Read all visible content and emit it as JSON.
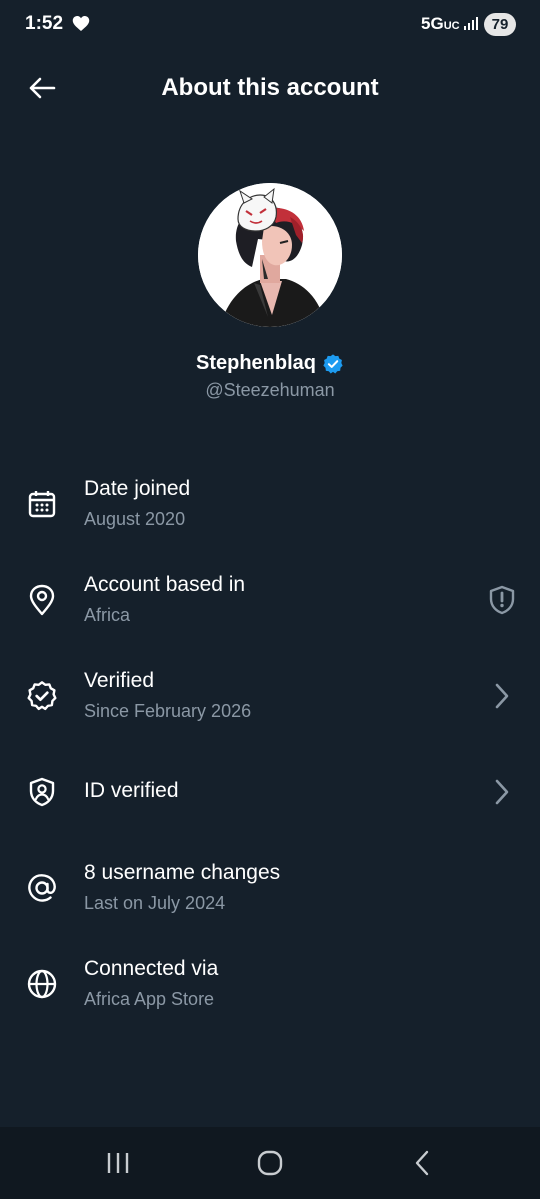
{
  "status_bar": {
    "time": "1:52",
    "network": "5G",
    "network_suffix": "UC",
    "battery": "79"
  },
  "header": {
    "title": "About this account",
    "back_icon": "arrow-left-icon"
  },
  "profile": {
    "name": "Stephenblaq",
    "handle": "@Steezehuman",
    "verified_color": "#1d9bf0"
  },
  "info_rows": [
    {
      "icon": "calendar-icon",
      "title": "Date joined",
      "subtitle": "August 2020"
    },
    {
      "icon": "location-pin-icon",
      "title": "Account based in",
      "subtitle": "Africa",
      "trailing": "shield-alert-icon"
    },
    {
      "icon": "verified-check-icon",
      "title": "Verified",
      "subtitle": "Since February 2026",
      "trailing": "chevron-right-icon"
    },
    {
      "icon": "id-shield-icon",
      "title": "ID verified",
      "trailing": "chevron-right-icon"
    },
    {
      "icon": "at-sign-icon",
      "title": "8 username changes",
      "subtitle": "Last on July 2024"
    },
    {
      "icon": "globe-icon",
      "title": "Connected via",
      "subtitle": "Africa App Store"
    }
  ],
  "nav": {
    "recents": "recents-icon",
    "home": "home-icon",
    "back": "back-icon"
  },
  "colors": {
    "background": "#15202b",
    "secondary_text": "#8b98a5",
    "accent": "#1d9bf0"
  }
}
